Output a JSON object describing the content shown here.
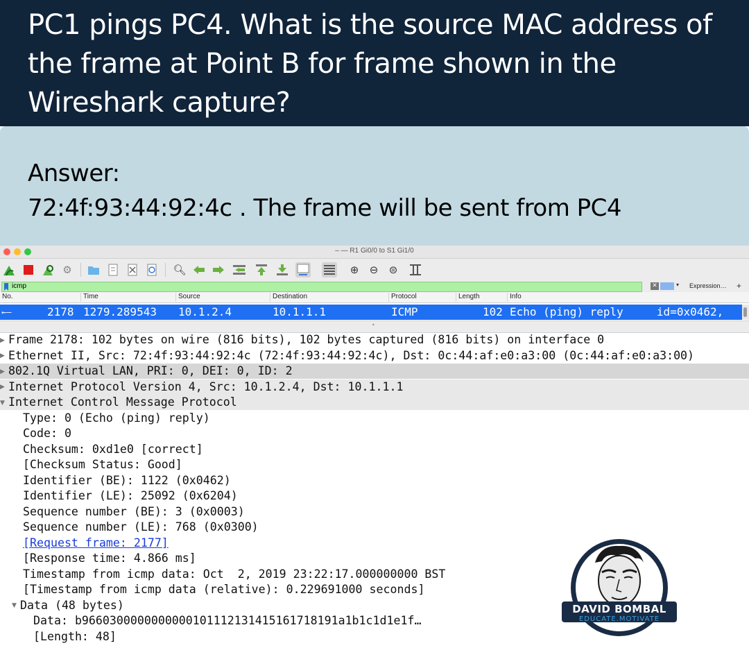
{
  "question": {
    "lines": [
      "PC1 pings PC4. What is the source MAC address of",
      "the frame at Point B for frame shown in the",
      "Wireshark capture?"
    ]
  },
  "answer": {
    "label": "Answer:",
    "text": "72:4f:93:44:92:4c . The frame will be sent from PC4"
  },
  "window": {
    "title": "– — R1 Gi0/0 to S1 Gi1/0"
  },
  "filter": {
    "value": "icmp",
    "expression_label": "Expression…",
    "plus_label": "+"
  },
  "columns": [
    "No.",
    "Time",
    "Source",
    "Destination",
    "Protocol",
    "Length",
    "Info"
  ],
  "packet": {
    "no": "2178",
    "time": "1279.289543",
    "source": "10.1.2.4",
    "destination": "10.1.1.1",
    "protocol": "ICMP",
    "length": "102",
    "info": "Echo (ping) reply     id=0x0462,"
  },
  "details": [
    "Frame 2178: 102 bytes on wire (816 bits), 102 bytes captured (816 bits) on interface 0",
    "Ethernet II, Src: 72:4f:93:44:92:4c (72:4f:93:44:92:4c), Dst: 0c:44:af:e0:a3:00 (0c:44:af:e0:a3:00)",
    "802.1Q Virtual LAN, PRI: 0, DEI: 0, ID: 2",
    "Internet Protocol Version 4, Src: 10.1.2.4, Dst: 10.1.1.1",
    "Internet Control Message Protocol",
    "Type: 0 (Echo (ping) reply)",
    "Code: 0",
    "Checksum: 0xd1e0 [correct]",
    "[Checksum Status: Good]",
    "Identifier (BE): 1122 (0x0462)",
    "Identifier (LE): 25092 (0x6204)",
    "Sequence number (BE): 3 (0x0003)",
    "Sequence number (LE): 768 (0x0300)",
    "[Request frame: 2177]",
    "[Response time: 4.866 ms]",
    "Timestamp from icmp data: Oct  2, 2019 23:22:17.000000000 BST",
    "[Timestamp from icmp data (relative): 0.229691000 seconds]",
    "Data (48 bytes)",
    "Data: b9660300000000000101112131415161718191a1b1c1d1e1f…",
    "[Length: 48]"
  ],
  "logo": {
    "name": "DAVID BOMBAL",
    "tagline": "EDUCATE.MOTIVATE"
  },
  "colors": {
    "question_bg": "#10243a",
    "answer_bg": "#c2d9e1",
    "selected_row": "#1e6ff2",
    "filter_ok": "#aef0a4"
  }
}
